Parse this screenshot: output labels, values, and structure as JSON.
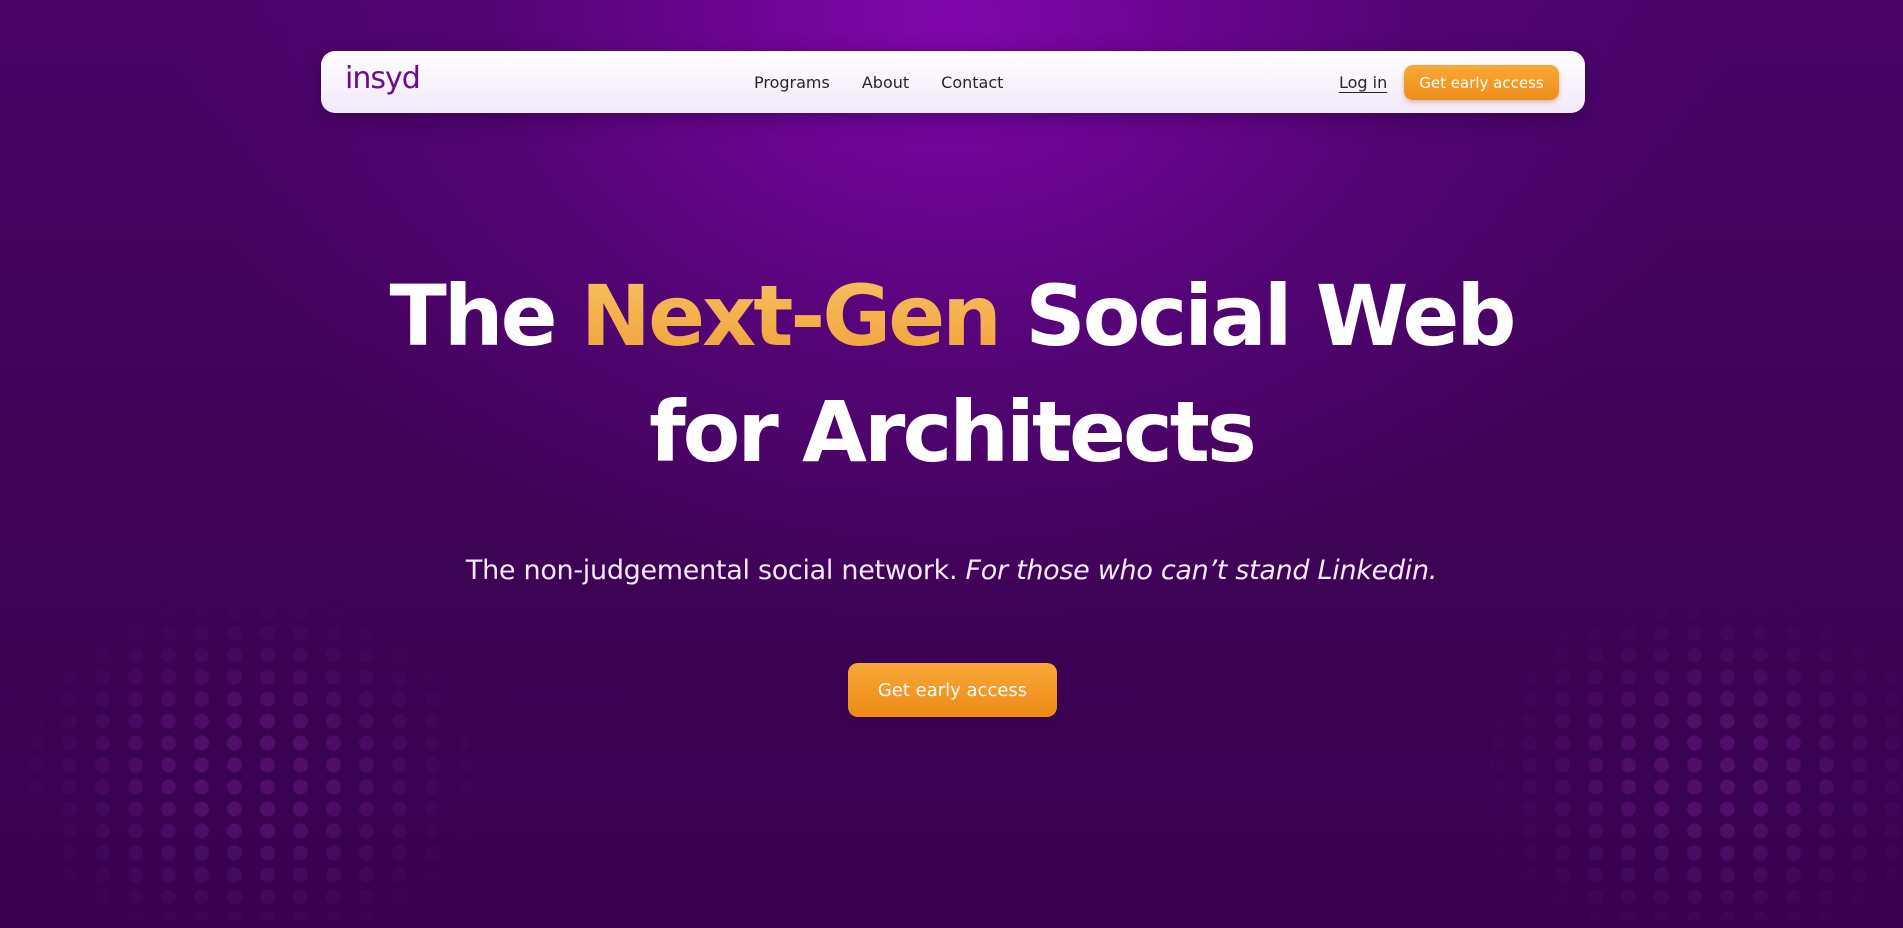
{
  "brand": {
    "logo_text": "insyd",
    "logo_color": "#6d0b8f"
  },
  "nav": {
    "links": [
      {
        "label": "Programs"
      },
      {
        "label": "About"
      },
      {
        "label": "Contact"
      }
    ],
    "login_label": "Log in",
    "cta_label": "Get early access"
  },
  "hero": {
    "headline_part1": "The ",
    "headline_highlight": "Next-Gen",
    "headline_part2": " Social Web",
    "headline_line2": "for Architects",
    "subtitle_regular": "The non-judgemental social network. ",
    "subtitle_italic": "For those who can’t stand Linkedin.",
    "cta_label": "Get early access"
  },
  "colors": {
    "background": "#4a0467",
    "glow": "#8006ab",
    "accent_orange": "#f39a25",
    "highlight_text": "#f5b04d"
  }
}
